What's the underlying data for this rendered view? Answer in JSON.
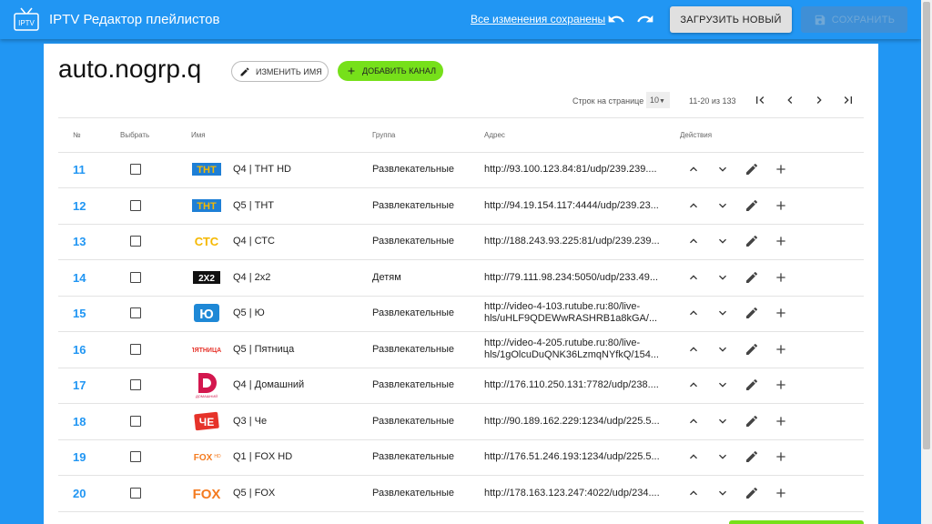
{
  "app": {
    "title": "IPTV Редактор плейлистов",
    "logo_text": "IPTV",
    "saved_status": "Все изменения сохранены",
    "upload_button": "ЗАГРУЗИТЬ НОВЫЙ",
    "save_button": "СОХРАНИТЬ",
    "accent_color": "#2196f3",
    "green_color": "#76e01a"
  },
  "playlist": {
    "title": "auto.nogrp.q",
    "rename_button": "ИЗМЕНИТЬ ИМЯ",
    "add_channel_button": "ДОБАВИТЬ КАНАЛ"
  },
  "pagination": {
    "rows_per_page_label": "Строк на странице",
    "rows_per_page_value": "10",
    "range_text": "11-20 из 133"
  },
  "table": {
    "headers": {
      "num": "№",
      "select": "Выбрать",
      "name": "Имя",
      "group": "Группа",
      "address": "Адрес",
      "actions": "Действия"
    },
    "rows": [
      {
        "num": "11",
        "name": "Q4 | ТНТ HD",
        "group": "Развлекательные",
        "address": "http://93.100.123.84:81/udp/239.239....",
        "logo": "tnt-logo",
        "logo_text": "ТНТ"
      },
      {
        "num": "12",
        "name": "Q5 | ТНТ",
        "group": "Развлекательные",
        "address": "http://94.19.154.117:4444/udp/239.23...",
        "logo": "tnt-logo",
        "logo_text": "ТНТ"
      },
      {
        "num": "13",
        "name": "Q4 | СТС",
        "group": "Развлекательные",
        "address": "http://188.243.93.225:81/udp/239.239....",
        "logo": "sts-logo",
        "logo_text": "СТС"
      },
      {
        "num": "14",
        "name": "Q4 | 2x2",
        "group": "Детям",
        "address": "http://79.111.98.234:5050/udp/233.49....",
        "logo": "2x2-logo",
        "logo_text": "2X2"
      },
      {
        "num": "15",
        "name": "Q5 | Ю",
        "group": "Развлекательные",
        "address": "http://video-4-103.rutube.ru:80/live-hls/uHLF9QDEWwRASHRB1a8kGA/...",
        "logo": "yu-logo",
        "logo_text": "Ю"
      },
      {
        "num": "16",
        "name": "Q5 | Пятница",
        "group": "Развлекательные",
        "address": "http://video-4-205.rutube.ru:80/live-hls/1gOlcuDuQNK36LzmqNYfkQ/154...",
        "logo": "pyatnica-logo",
        "logo_text": "ПЯТНИЦА!"
      },
      {
        "num": "17",
        "name": "Q4 | Домашний",
        "group": "Развлекательные",
        "address": "http://176.110.250.131:7782/udp/238....",
        "logo": "domashniy-logo",
        "logo_text": "ДОМАШНИЙ"
      },
      {
        "num": "18",
        "name": "Q3 | Че",
        "group": "Развлекательные",
        "address": "http://90.189.162.229:1234/udp/225.5...",
        "logo": "che-logo",
        "logo_text": "ЧЕ"
      },
      {
        "num": "19",
        "name": "Q1 | FOX HD",
        "group": "Развлекательные",
        "address": "http://176.51.246.193:1234/udp/225.5...",
        "logo": "fox-hd-logo",
        "logo_text": "FOX"
      },
      {
        "num": "20",
        "name": "Q5 | FOX",
        "group": "Развлекательные",
        "address": "http://178.163.123.247:4022/udp/234....",
        "logo": "fox-logo",
        "logo_text": "FOX"
      }
    ]
  }
}
